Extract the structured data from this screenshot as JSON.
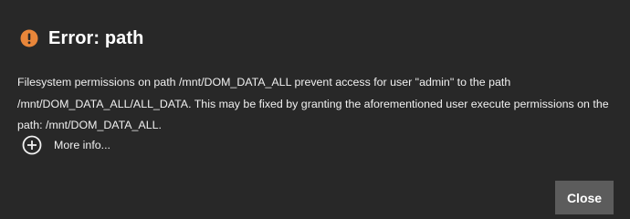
{
  "dialog": {
    "title": "Error: path",
    "message": "Filesystem permissions on path /mnt/DOM_DATA_ALL prevent access for user \"admin\" to the path /mnt/DOM_DATA_ALL/ALL_DATA. This may be fixed by granting the aforementioned user execute permissions on the path: /mnt/DOM_DATA_ALL.",
    "more_info_label": "More info...",
    "close_label": "Close",
    "icons": {
      "title_icon": "error-icon",
      "more_info_icon": "plus-circle-icon"
    },
    "colors": {
      "background": "#282828",
      "error_accent": "#e8863a",
      "button_background": "#5c5c5c"
    }
  }
}
